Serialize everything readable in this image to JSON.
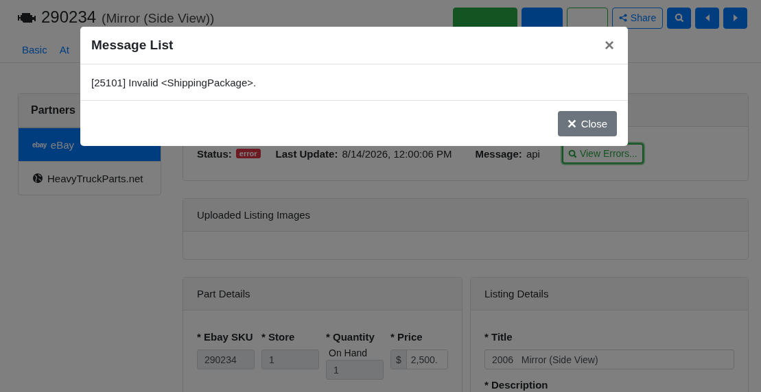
{
  "header": {
    "part_number": "290234",
    "description": "(Mirror (Side View))",
    "actions": [
      {
        "kind": "success"
      },
      {
        "kind": "primary"
      },
      {
        "kind": "outline-success"
      },
      {
        "kind": "share",
        "label": "Share"
      },
      {
        "kind": "search"
      },
      {
        "kind": "prev"
      },
      {
        "kind": "next"
      }
    ]
  },
  "tabs": [
    {
      "label": "Basic"
    },
    {
      "label": "At"
    }
  ],
  "partners": {
    "title": "Partners",
    "items": [
      {
        "kind": "ebay",
        "logo": "ebay",
        "label": "eBay",
        "selected": true
      },
      {
        "kind": "web",
        "label": "HeavyTruckParts.net",
        "selected": false
      }
    ]
  },
  "status": {
    "status_label": "Status:",
    "status": "error",
    "last_update_label": "Last Update:",
    "last_update": "8/14/2026, 12:00:06 PM",
    "message_label": "Message:",
    "message": "api",
    "view_errors": "View Errors..."
  },
  "uploaded_images": {
    "title": "Uploaded Listing Images"
  },
  "part_details": {
    "title": "Part Details",
    "fields": [
      {
        "label": "* Ebay SKU",
        "value": "290234"
      },
      {
        "label": "* Store",
        "value": "1"
      },
      {
        "label": "* Quantity",
        "sublabel": "On Hand",
        "value": "1"
      },
      {
        "label": "* Price",
        "prefix": "$",
        "value": "2,500."
      }
    ]
  },
  "listing_details": {
    "title": "Listing Details",
    "fields": [
      {
        "label": "* Title",
        "value": "2006   Mirror (Side View)"
      },
      {
        "label": "* Description"
      }
    ]
  },
  "modal": {
    "title": "Message List",
    "dismiss": "×",
    "messages": [
      "[25101] Invalid <ShippingPackage>."
    ],
    "close_button": "Close"
  }
}
